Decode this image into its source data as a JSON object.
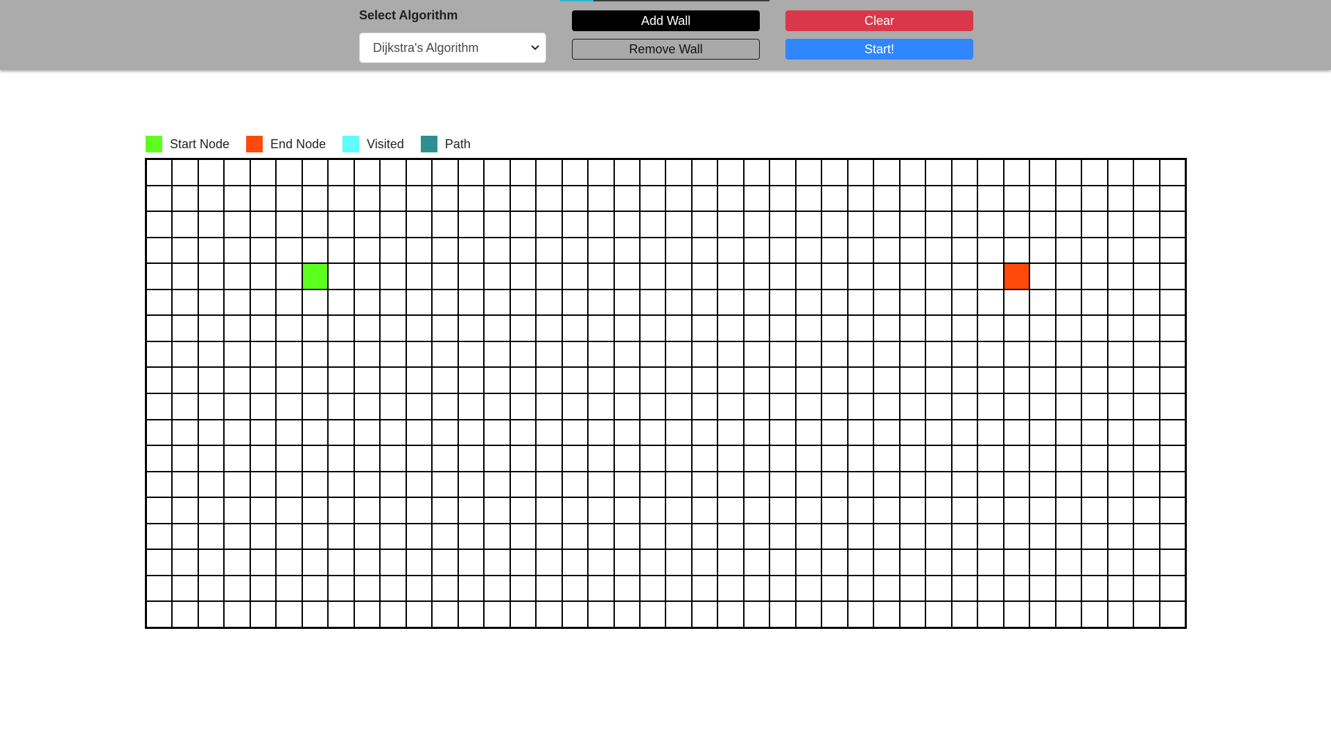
{
  "toolbar": {
    "progress_fraction": 0.16,
    "select_label": "Select Algorithm",
    "selected_algorithm": "Dijkstra's Algorithm",
    "add_wall_label": "Add Wall",
    "remove_wall_label": "Remove Wall",
    "clear_label": "Clear",
    "start_label": "Start!"
  },
  "legend": [
    {
      "label": "Start Node",
      "color": "#5cff1e"
    },
    {
      "label": "End Node",
      "color": "#ff4a0c"
    },
    {
      "label": "Visited",
      "color": "#5ffcfc"
    },
    {
      "label": "Path",
      "color": "#2e8f8f"
    }
  ],
  "grid": {
    "rows": 18,
    "cols": 40,
    "start": {
      "row": 4,
      "col": 6
    },
    "end": {
      "row": 4,
      "col": 33
    }
  }
}
